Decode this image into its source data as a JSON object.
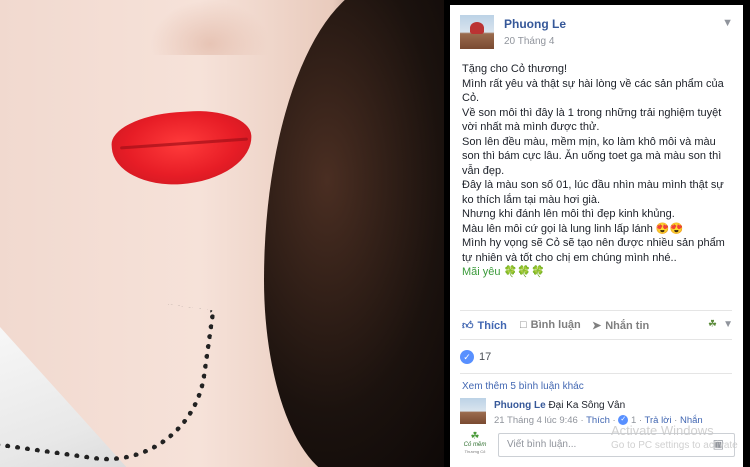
{
  "post": {
    "author": "Phuong Le",
    "date": "20 Tháng 4",
    "paragraphs": [
      "Tặng cho Cỏ thương!",
      "Mình rất yêu và thật sự hài lòng về các sản phẩm của Cỏ.",
      "Về son môi thì đây là 1 trong những trải nghiệm tuyệt vời nhất mà mình được thử.",
      "Son lên đều màu, mềm mịn, ko làm khô môi và màu son thì bám cực lâu. Ăn uống toet ga mà màu son thì vẫn đẹp.",
      "Đây là màu son số 01, lúc đầu nhìn màu mình thật sự ko thích lắm tại màu hơi già.",
      "Nhưng khi đánh lên môi thì đẹp kinh khủng.",
      "Màu lên môi cứ gọi là lung linh lấp lánh 😍😍",
      "Mình hy vọng sẽ Cỏ sẽ tạo nên được nhiều sản phẩm tự nhiên và tốt cho chị em chúng mình nhé..",
      "Mãi yêu 🍀🍀🍀"
    ]
  },
  "actions": {
    "like": "Thích",
    "comment": "Bình luận",
    "share": "Nhắn tin"
  },
  "likes": {
    "count": "17"
  },
  "comments": {
    "more": "Xem thêm 5 bình luận khác",
    "items": [
      {
        "author": "Phuong Le",
        "text": "Đại Ka Sông Vân",
        "time": "21 Tháng 4 lúc 9:46",
        "like": "Thích",
        "reactions": "1",
        "reply": "Trả lời",
        "message": "Nhắn"
      }
    ],
    "placeholder": "Viết bình luận...",
    "page_name": "Cỏ mềm",
    "page_sub": "Thương Cỏ"
  },
  "watermark": {
    "line1": "Activate Windows",
    "line2": "Go to PC settings to activate"
  },
  "colors": {
    "link": "#365899",
    "accent": "#4267b2",
    "lip": "#e71d26"
  }
}
